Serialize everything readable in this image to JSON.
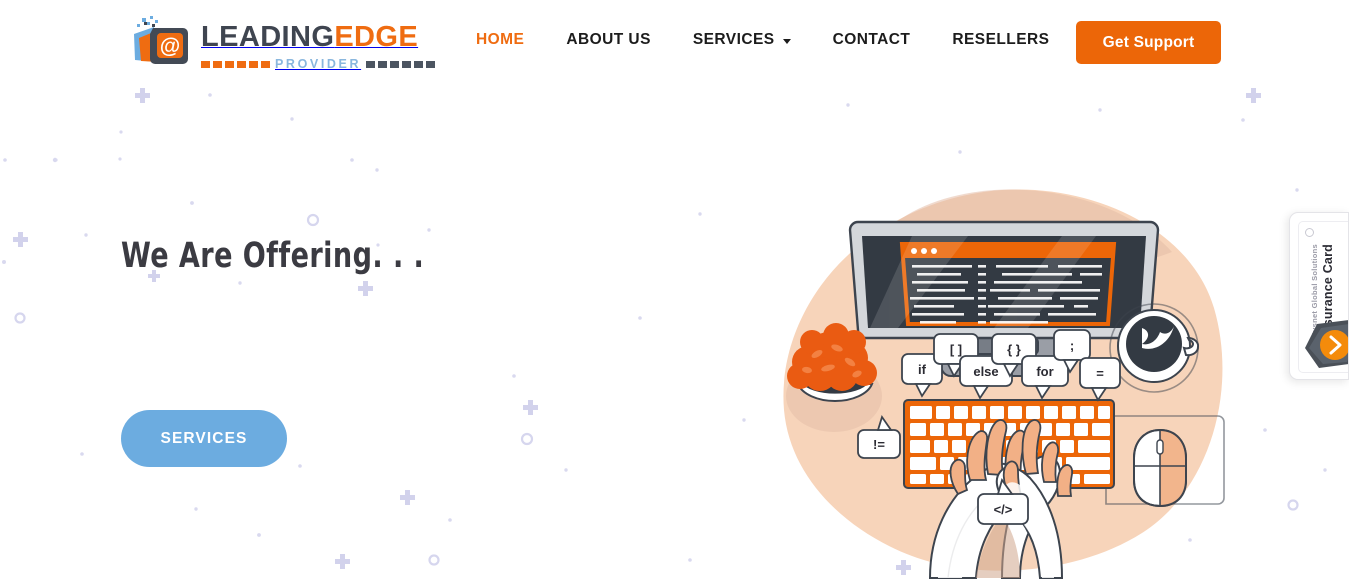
{
  "page": {
    "background_color": "#ffffff",
    "accent_orange": "#ec6608",
    "accent_blue": "#6cace0",
    "heading_color": "#3b3b42"
  },
  "header": {
    "logo": {
      "icon_name": "leading-edge-logo-mark",
      "word_primary": "LEADING",
      "word_accent": "EDGE",
      "subtitle": "PROVIDER"
    },
    "nav": [
      {
        "label": "HOME",
        "active": true,
        "has_dropdown": false
      },
      {
        "label": "ABOUT US",
        "active": false,
        "has_dropdown": false
      },
      {
        "label": "SERVICES",
        "active": false,
        "has_dropdown": true
      },
      {
        "label": "CONTACT",
        "active": false,
        "has_dropdown": false
      },
      {
        "label": "RESELLERS",
        "active": false,
        "has_dropdown": false
      }
    ],
    "cta": {
      "label": "Get Support",
      "color": "#ec6608"
    }
  },
  "hero": {
    "heading": "We Are Offering. . .",
    "button": {
      "label": "SERVICES",
      "color": "#6cace0"
    },
    "illustration": {
      "name": "developer-coding-desk-illustration",
      "blob_color": "#f6d2b8",
      "code_bubbles": [
        "if",
        "[ ]",
        "else",
        "{ }",
        "for",
        ";",
        "=",
        "!=",
        "</>"
      ],
      "objects": [
        "monitor",
        "code-editor-window",
        "keyboard",
        "hands",
        "mouse",
        "coffee-cup",
        "potted-plant"
      ]
    }
  },
  "assurance_widget": {
    "subtitle": "Sysnet Global Solutions",
    "title": "Assurance Card",
    "badge_icon": "orange-chevron-badge"
  }
}
